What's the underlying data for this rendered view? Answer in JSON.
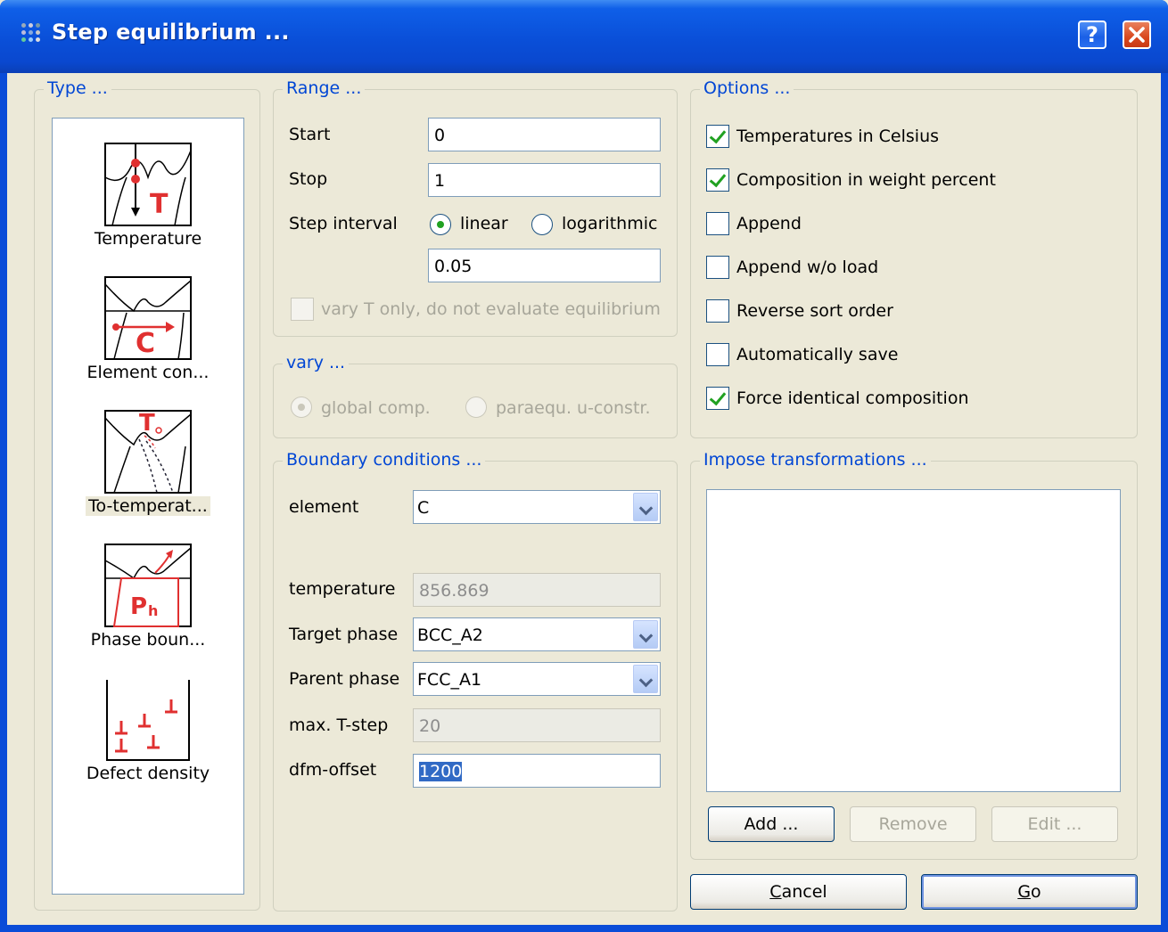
{
  "window": {
    "title": "Step equilibrium ...",
    "help_button": "?",
    "close_button": "✕"
  },
  "type_group": {
    "legend": "Type ...",
    "items": [
      {
        "label": "Temperature",
        "icon": "temperature-diagram-icon"
      },
      {
        "label": "Element con...",
        "icon": "element-concentration-diagram-icon"
      },
      {
        "label": "To-temperat...",
        "icon": "to-temperature-diagram-icon",
        "selected": true
      },
      {
        "label": "Phase boun...",
        "icon": "phase-boundary-diagram-icon"
      },
      {
        "label": "Defect density",
        "icon": "defect-density-icon"
      }
    ]
  },
  "range_group": {
    "legend": "Range ...",
    "start_label": "Start",
    "start_value": "0",
    "stop_label": "Stop",
    "stop_value": "1",
    "step_interval_label": "Step interval",
    "linear_label": "linear",
    "logarithmic_label": "logarithmic",
    "step_value": "0.05",
    "vary_t_label": "vary T only, do not evaluate equilibrium"
  },
  "vary_group": {
    "legend": "vary ...",
    "global_comp_label": "global comp.",
    "paraequ_label": "paraequ. u-constr."
  },
  "boundary_group": {
    "legend": "Boundary conditions ...",
    "element_label": "element",
    "element_value": "C",
    "temperature_label": "temperature",
    "temperature_value": "856.869",
    "target_phase_label": "Target phase",
    "target_phase_value": "BCC_A2",
    "parent_phase_label": "Parent phase",
    "parent_phase_value": "FCC_A1",
    "max_tstep_label": "max. T-step",
    "max_tstep_value": "20",
    "dfm_offset_label": "dfm-offset",
    "dfm_offset_value": "1200"
  },
  "options_group": {
    "legend": "Options ...",
    "items": [
      {
        "label": "Temperatures in Celsius",
        "checked": true
      },
      {
        "label": "Composition in weight percent",
        "checked": true
      },
      {
        "label": "Append",
        "checked": false
      },
      {
        "label": "Append w/o load",
        "checked": false
      },
      {
        "label": "Reverse sort order",
        "checked": false
      },
      {
        "label": "Automatically save",
        "checked": false
      },
      {
        "label": "Force identical composition",
        "checked": true
      }
    ]
  },
  "transform_group": {
    "legend": "Impose transformations ...",
    "add_label": "Add ...",
    "remove_label": "Remove",
    "edit_label": "Edit ..."
  },
  "footer": {
    "cancel_label": "Cancel",
    "go_label": "Go"
  },
  "colors": {
    "titlebar": "#0a4fd8",
    "legend_text": "#0046d5",
    "dialog_bg": "#ece9d8",
    "check_green": "#21a121",
    "icon_red": "#e03030"
  }
}
